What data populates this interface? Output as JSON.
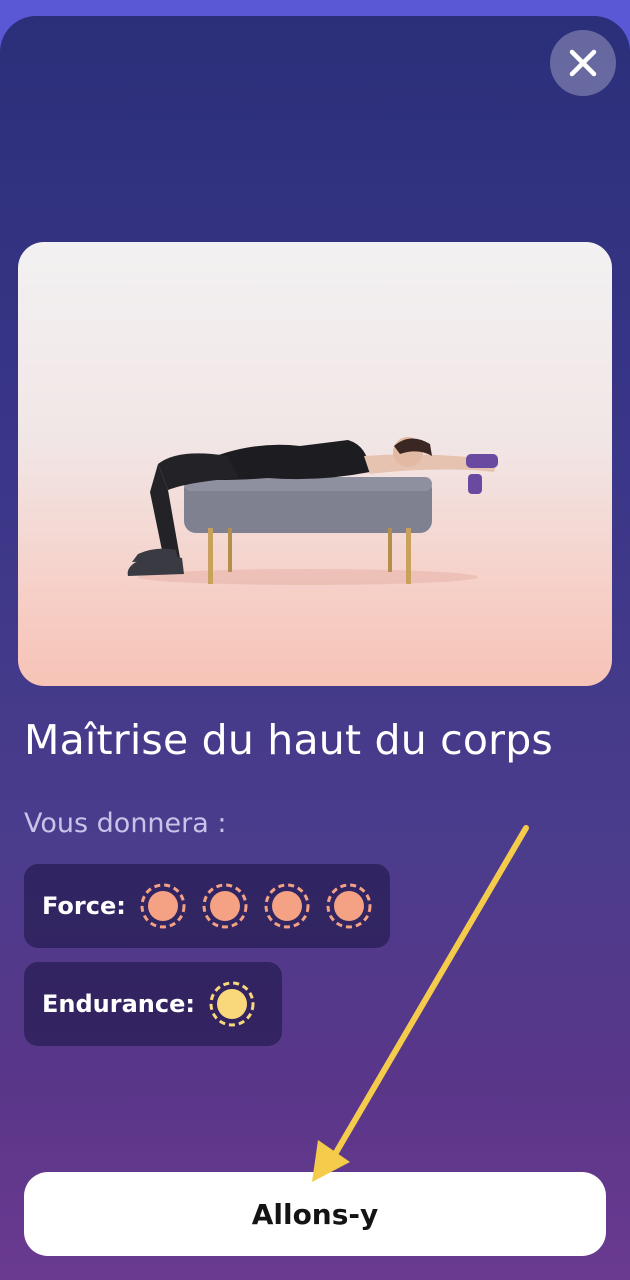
{
  "header": {
    "close_icon": "close-icon"
  },
  "hero": {
    "image_subject": "woman lying on bench with dumbbell"
  },
  "workout": {
    "title": "Maîtrise du haut du corps",
    "gives_label": "Vous donnera :",
    "stats": [
      {
        "label": "Force:",
        "level": 4,
        "color": "#f5a184"
      },
      {
        "label": "Endurance:",
        "level": 1,
        "color": "#f9d77b"
      }
    ]
  },
  "cta": {
    "label": "Allons-y"
  },
  "colors": {
    "background_top": "#2b2f7a",
    "background_bottom": "#6a3a90",
    "arrow": "#f4cb4a",
    "force_dot": "#f5a184",
    "endurance_dot": "#f9d77b"
  }
}
